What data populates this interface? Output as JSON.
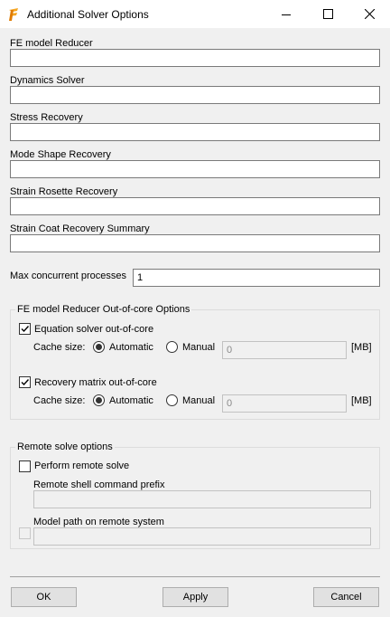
{
  "window": {
    "title": "Additional Solver Options"
  },
  "fields": [
    {
      "label": "FE model Reducer",
      "value": ""
    },
    {
      "label": "Dynamics Solver",
      "value": ""
    },
    {
      "label": "Stress Recovery",
      "value": ""
    },
    {
      "label": "Mode Shape Recovery",
      "value": ""
    },
    {
      "label": "Strain Rosette Recovery",
      "value": ""
    },
    {
      "label": "Strain Coat Recovery Summary",
      "value": ""
    }
  ],
  "concurrency": {
    "label": "Max concurrent processes",
    "value": "1"
  },
  "ooc": {
    "title": "FE model Reducer Out-of-core Options",
    "equation": {
      "label": "Equation solver out-of-core",
      "checked": true,
      "cache_label": "Cache size:",
      "automatic": "Automatic",
      "manual": "Manual",
      "value": "0",
      "unit": "[MB]",
      "selected": "Automatic"
    },
    "recovery": {
      "label": "Recovery matrix out-of-core",
      "checked": true,
      "cache_label": "Cache size:",
      "automatic": "Automatic",
      "manual": "Manual",
      "value": "0",
      "unit": "[MB]",
      "selected": "Automatic"
    }
  },
  "remote": {
    "title": "Remote solve options",
    "perform": {
      "label": "Perform remote solve",
      "checked": false
    },
    "prefix": {
      "label": "Remote shell command prefix",
      "value": ""
    },
    "model_path": {
      "label": "Model path on remote system",
      "value": "",
      "checked": false
    }
  },
  "buttons": {
    "ok": "OK",
    "apply": "Apply",
    "cancel": "Cancel"
  },
  "colors": {
    "icon_orange": "#f5a623",
    "icon_dark_orange": "#e07b00"
  }
}
